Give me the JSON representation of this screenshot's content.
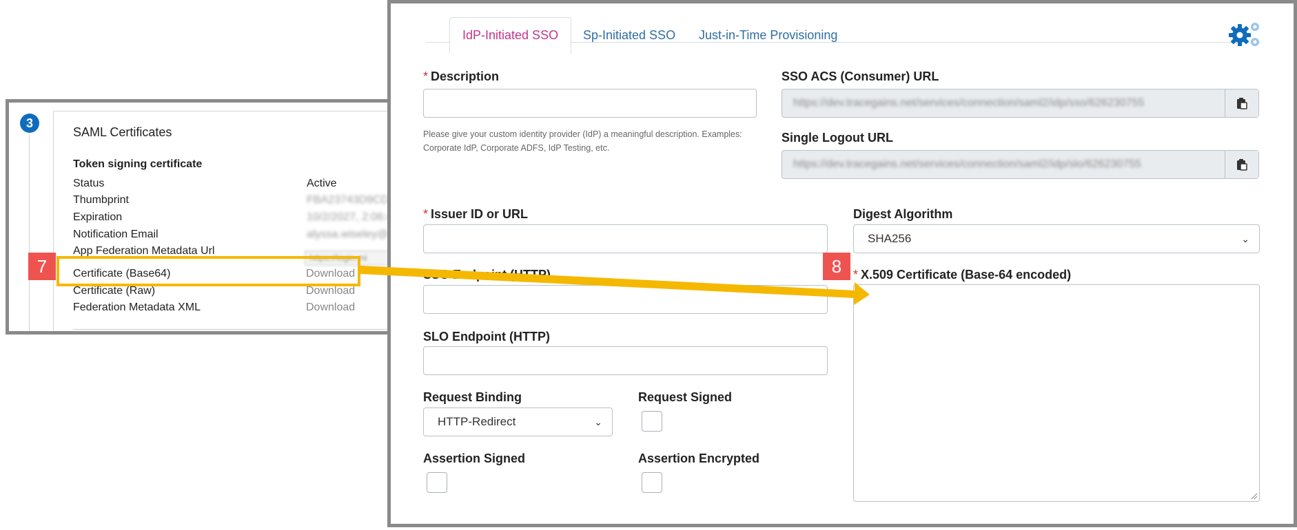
{
  "azure": {
    "step_number": "3",
    "title": "SAML Certificates",
    "subtitle": "Token signing certificate",
    "rows": [
      {
        "label": "Status",
        "value": "Active"
      },
      {
        "label": "Thumbprint",
        "value": "FBA23743D9CD4"
      },
      {
        "label": "Expiration",
        "value": "10/2/2027, 2:06:4"
      },
      {
        "label": "Notification Email",
        "value": "alyssa.wiseley@"
      },
      {
        "label": "App Federation Metadata Url",
        "value": "https://login.mi"
      }
    ],
    "downloads": [
      {
        "label": "Certificate (Base64)",
        "action": "Download"
      },
      {
        "label": "Certificate (Raw)",
        "action": "Download"
      },
      {
        "label": "Federation Metadata XML",
        "action": "Download"
      }
    ]
  },
  "tg": {
    "tabs": [
      "IdP-Initiated SSO",
      "Sp-Initiated SSO",
      "Just-in-Time Provisioning"
    ],
    "active_tab": "IdP-Initiated SSO",
    "required_mark": "*",
    "description": {
      "label": "Description",
      "value": ""
    },
    "description_help": "Please give your custom identity provider (IdP) a meaningful description. Examples: Corporate IdP, Corporate ADFS, IdP Testing, etc.",
    "acs_url": {
      "label": "SSO ACS (Consumer) URL",
      "value": "https://dev.tracegains.net/services/connection/saml2/idp/sso/626230755"
    },
    "slo_url": {
      "label": "Single Logout URL",
      "value": "https://dev.tracegains.net/services/connection/saml2/idp/slo/626230755"
    },
    "issuer": {
      "label": "Issuer ID or URL",
      "value": ""
    },
    "digest": {
      "label": "Digest Algorithm",
      "value": "SHA256"
    },
    "sso_endpoint": {
      "label": "SSO Endpoint (HTTP)",
      "value": ""
    },
    "certificate": {
      "label": "X.509 Certificate (Base-64 encoded)",
      "value": ""
    },
    "slo_endpoint": {
      "label": "SLO Endpoint (HTTP)",
      "value": ""
    },
    "request_binding": {
      "label": "Request Binding",
      "value": "HTTP-Redirect"
    },
    "request_signed": {
      "label": "Request Signed",
      "checked": false
    },
    "assertion_signed": {
      "label": "Assertion Signed",
      "checked": false
    },
    "assertion_encrypted": {
      "label": "Assertion Encrypted",
      "checked": false
    }
  },
  "callouts": [
    "7",
    "8"
  ],
  "colors": {
    "highlight": "#f5b800",
    "callout": "#ef5350",
    "active_tab": "#c2358c",
    "tab_link": "#2f6ea5",
    "gear": "#0f6cbd"
  },
  "icons": [
    "gear-icon",
    "clipboard-icon",
    "chevron-down-icon",
    "arrow-icon"
  ]
}
